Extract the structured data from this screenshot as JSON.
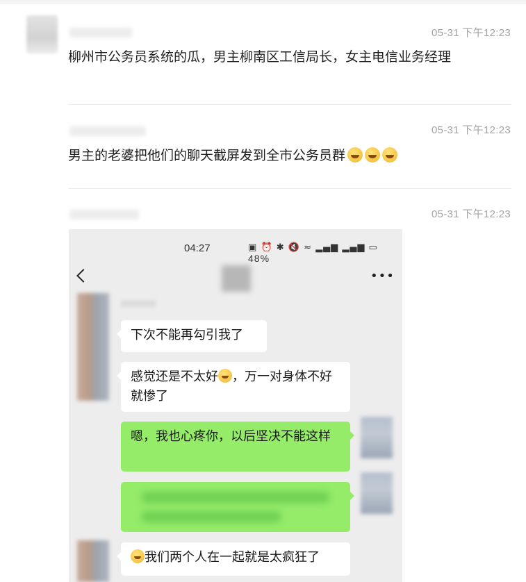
{
  "comments": [
    {
      "time": "05-31 下午12:23",
      "text": "柳州市公务员系统的瓜，男主柳南区工信局长，女主电信业务经理"
    },
    {
      "time": "05-31 下午12:23",
      "text": "男主的老婆把他们的聊天截屏发到全市公务员群",
      "emoji_count": 3,
      "emoji": "grinning-sweat-emoji"
    },
    {
      "time": "05-31 下午12:23"
    }
  ],
  "phone": {
    "status_time": "04:27",
    "status_icons": "nfc, alarm, bluetooth, mute, wifi, signal, battery",
    "battery": "48%",
    "messages": [
      {
        "side": "left",
        "text": "下次不能再勾引我了"
      },
      {
        "side": "left",
        "text_before": "感觉还是不太好",
        "text_after": "，万一对身体不好就惨了",
        "emoji": "laughing-emoji"
      },
      {
        "side": "right",
        "text": "嗯，我也心疼你，以后坚决不能这样"
      },
      {
        "side": "right",
        "text": ""
      },
      {
        "side": "left",
        "text": "我们两个人在一起就是太疯狂了",
        "emoji": "smile-emoji"
      }
    ]
  }
}
